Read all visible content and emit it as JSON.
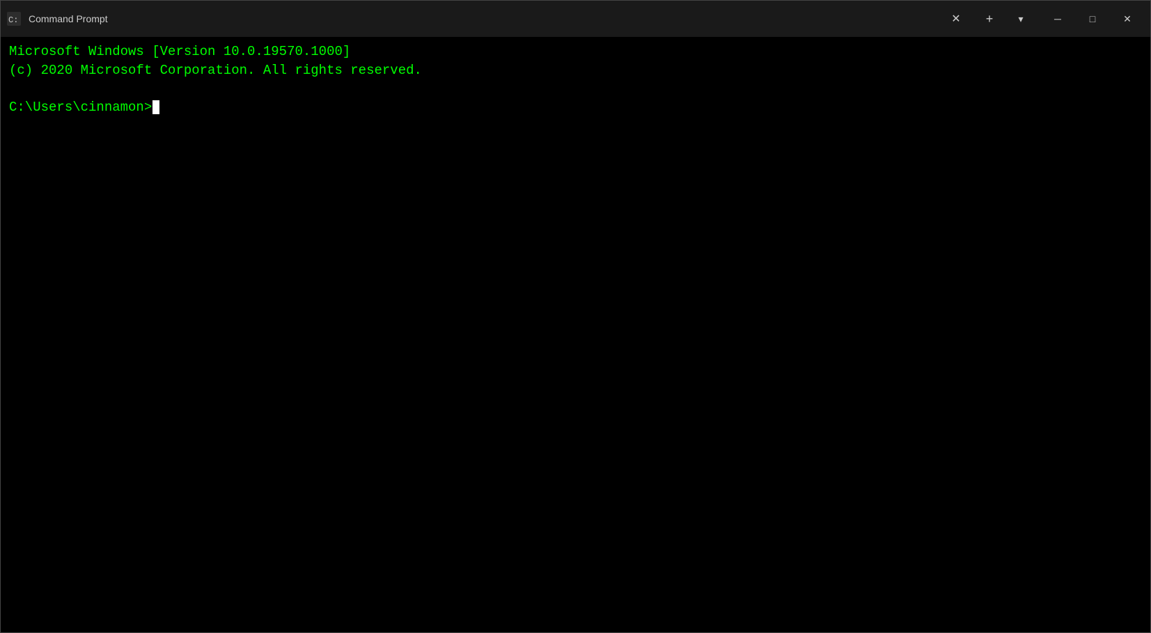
{
  "titlebar": {
    "title": "Command Prompt",
    "icon": "cmd-icon",
    "add_tab_label": "+",
    "dropdown_label": "▾",
    "close_tab_label": "✕",
    "minimize_label": "─",
    "maximize_label": "□",
    "close_label": "✕"
  },
  "terminal": {
    "line1": "Microsoft Windows [Version 10.0.19570.1000]",
    "line2": "(c) 2020 Microsoft Corporation. All rights reserved.",
    "prompt": "C:\\Users\\cinnamon>"
  }
}
